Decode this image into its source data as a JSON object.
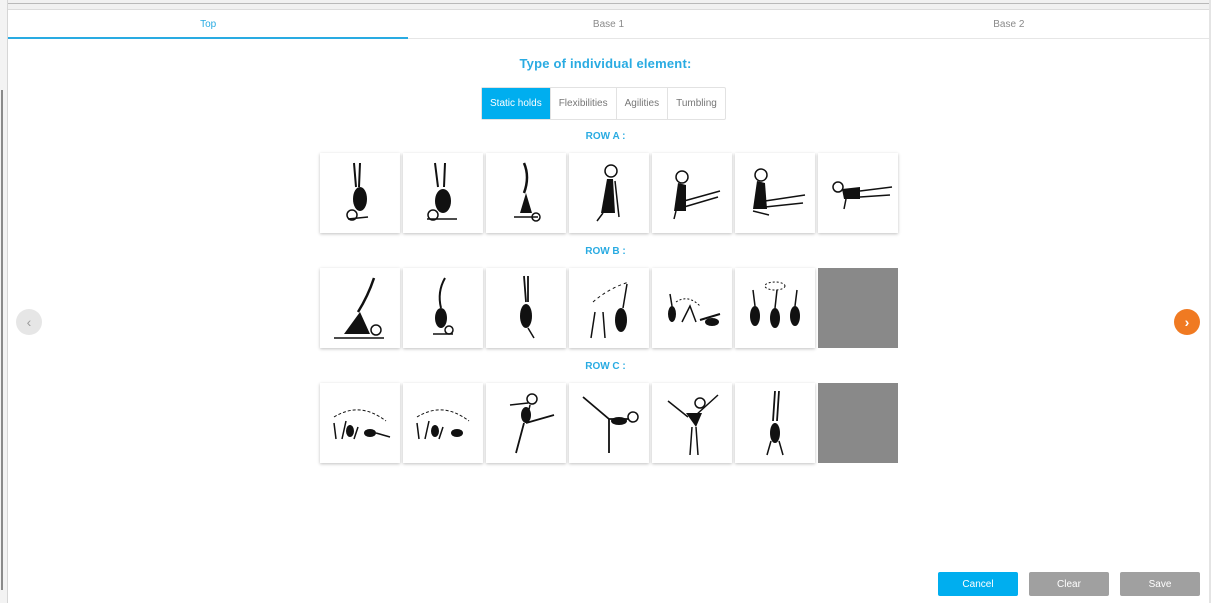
{
  "tabs": [
    {
      "label": "Top",
      "active": true
    },
    {
      "label": "Base 1",
      "active": false
    },
    {
      "label": "Base 2",
      "active": false
    }
  ],
  "heading": "Type of individual element:",
  "element_types": [
    {
      "label": "Static holds",
      "active": true
    },
    {
      "label": "Flexibilities",
      "active": false
    },
    {
      "label": "Agilities",
      "active": false
    },
    {
      "label": "Tumbling",
      "active": false
    }
  ],
  "rows": [
    {
      "label": "ROW A :",
      "items": [
        "figure",
        "figure",
        "figure",
        "figure",
        "figure",
        "figure",
        "figure"
      ]
    },
    {
      "label": "ROW B :",
      "items": [
        "figure",
        "figure",
        "figure",
        "figure",
        "figure",
        "figure",
        "empty"
      ]
    },
    {
      "label": "ROW C :",
      "items": [
        "figure",
        "figure",
        "figure",
        "figure",
        "figure",
        "figure",
        "empty"
      ]
    }
  ],
  "nav": {
    "prev_icon": "‹",
    "next_icon": "›"
  },
  "actions": {
    "cancel": "Cancel",
    "clear": "Clear",
    "save": "Save"
  },
  "colors": {
    "accent": "#29abe2",
    "active_segment": "#00aeef",
    "next_button": "#f07a22",
    "disabled_button": "#a0a0a0",
    "empty_cell": "#898989"
  }
}
